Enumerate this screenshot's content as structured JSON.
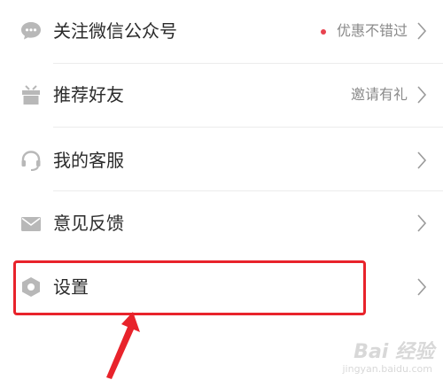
{
  "menu": {
    "items": [
      {
        "label": "关注微信公众号",
        "hint": "优惠不错过",
        "hint_dot": true,
        "icon": "wechat-icon"
      },
      {
        "label": "推荐好友",
        "hint": "邀请有礼",
        "hint_dot": false,
        "icon": "gift-icon"
      },
      {
        "label": "我的客服",
        "hint": "",
        "hint_dot": false,
        "icon": "headset-icon"
      },
      {
        "label": "意见反馈",
        "hint": "",
        "hint_dot": false,
        "icon": "mail-icon"
      },
      {
        "label": "设置",
        "hint": "",
        "hint_dot": false,
        "icon": "settings-hexagon-icon"
      }
    ]
  },
  "colors": {
    "icon_gray": "#b8b8b8",
    "label_text": "#2b2b2b",
    "hint_text": "#8a8a8a",
    "dot_red": "#e8424f",
    "annotation_red": "#e8232b"
  },
  "watermark": {
    "main": "Bai 经验",
    "url": "jingyan.baidu.com"
  }
}
